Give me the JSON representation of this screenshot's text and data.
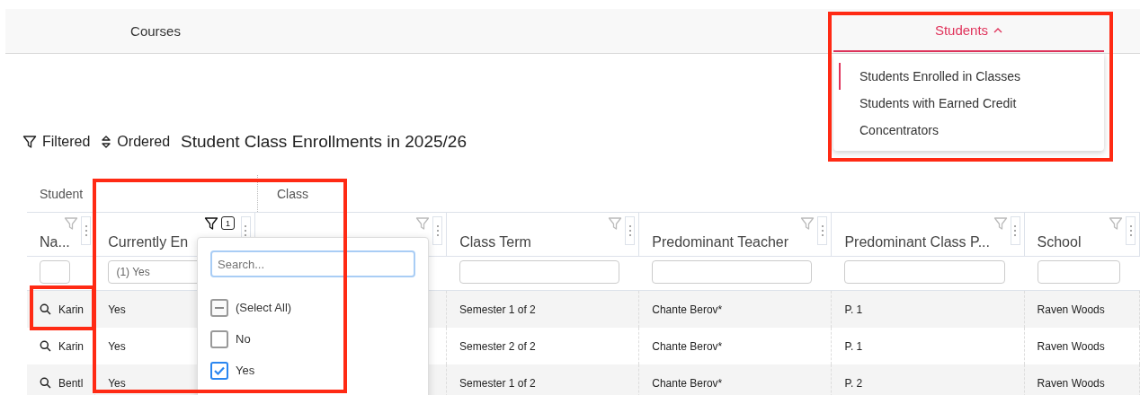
{
  "nav": {
    "tabs": [
      {
        "label": "Courses",
        "kind": "link",
        "selected": false
      },
      {
        "label": "Students",
        "kind": "menu",
        "selected": true,
        "expanded": true,
        "menu": [
          {
            "label": "Students Enrolled in Classes",
            "selected": true
          },
          {
            "label": "Students with Earned Credit",
            "selected": false
          },
          {
            "label": "Concentrators",
            "selected": false
          }
        ]
      }
    ]
  },
  "toolbar": {
    "items": [
      {
        "label": "Filtered",
        "kind": "filter"
      },
      {
        "label": "Ordered",
        "kind": "order"
      }
    ],
    "title": "Student Class Enrollments in 2025/26"
  },
  "table": {
    "groups": [
      {
        "label": "Student",
        "columns": [
          {
            "header": "Na...",
            "filtered": false
          },
          {
            "header": "Currently En",
            "filtered": true,
            "filter_count": "1",
            "filter_value": "(1) Yes"
          }
        ]
      },
      {
        "label": "Class",
        "columns": [
          {
            "filtered": false
          },
          {
            "header": "Class Term",
            "filtered": false
          },
          {
            "header": "Predominant Teacher",
            "filtered": false
          },
          {
            "header": "Predominant Class P...",
            "filtered": false
          },
          {
            "header": "School",
            "filtered": false
          }
        ]
      }
    ],
    "rows": [
      {
        "cells": [
          "Karin",
          "Yes",
          null,
          "Semester 1 of 2",
          "Chante Berov*",
          "P. 1",
          "Raven Woods"
        ]
      },
      {
        "cells": [
          "Karin",
          "Yes",
          null,
          "Semester 2 of 2",
          "Chante Berov*",
          "P. 1",
          "Raven Woods"
        ]
      },
      {
        "cells": [
          "Bentl",
          "Yes",
          null,
          "Semester 1 of 2",
          "Chante Berov*",
          "P. 2",
          "Raven Woods"
        ]
      }
    ]
  },
  "filter_popup": {
    "placeholder": "Search...",
    "options": [
      {
        "label": "(Select All)",
        "kind": "select_all",
        "indeterminate": true
      },
      {
        "label": "No",
        "kind": "option",
        "checked": false
      },
      {
        "label": "Yes",
        "kind": "option",
        "checked": true
      }
    ]
  },
  "annotations": [
    {
      "kind": "menu"
    },
    {
      "kind": "column"
    },
    {
      "kind": "cell"
    }
  ]
}
